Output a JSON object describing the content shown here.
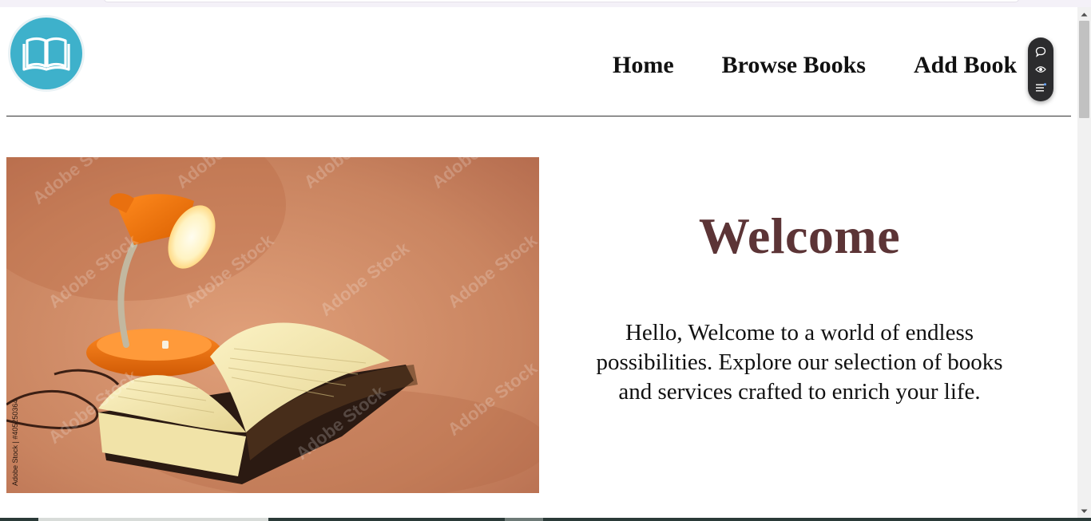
{
  "nav": {
    "items": [
      {
        "label": "Home"
      },
      {
        "label": "Browse Books"
      },
      {
        "label": "Add Book"
      }
    ]
  },
  "hero": {
    "title": "Welcome",
    "intro": "Hello, Welcome to a world of endless possibilities. Explore our selection of books and services crafted to enrich your life.",
    "image": {
      "watermark": "Adobe Stock",
      "credit": "Adobe Stock | #405250364"
    }
  },
  "toolbar": {
    "buttons": [
      {
        "icon": "chat-bubble-icon"
      },
      {
        "icon": "eye-icon"
      },
      {
        "icon": "list-icon"
      }
    ]
  },
  "colors": {
    "logo_bg": "#3eb1cb",
    "welcome_text": "#5c3436",
    "image_bg": "#c8845e"
  }
}
